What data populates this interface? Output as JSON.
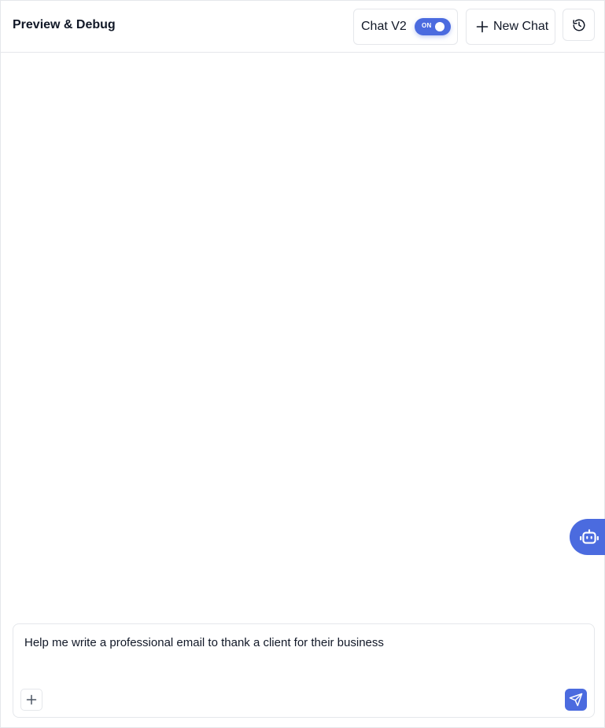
{
  "header": {
    "title": "Preview & Debug",
    "chat_v2_label": "Chat V2",
    "chat_v2_toggle": {
      "state_text": "ON",
      "on": true
    },
    "new_chat_label": "New Chat",
    "history_icon": "history-icon"
  },
  "floating": {
    "bot_icon": "robot-icon"
  },
  "composer": {
    "text": "Help me write a professional email to thank a client for their business",
    "attach_icon": "plus-icon",
    "send_icon": "send-icon"
  },
  "colors": {
    "accent": "#4b6bdf",
    "border": "#e5e7eb",
    "text": "#111827"
  }
}
